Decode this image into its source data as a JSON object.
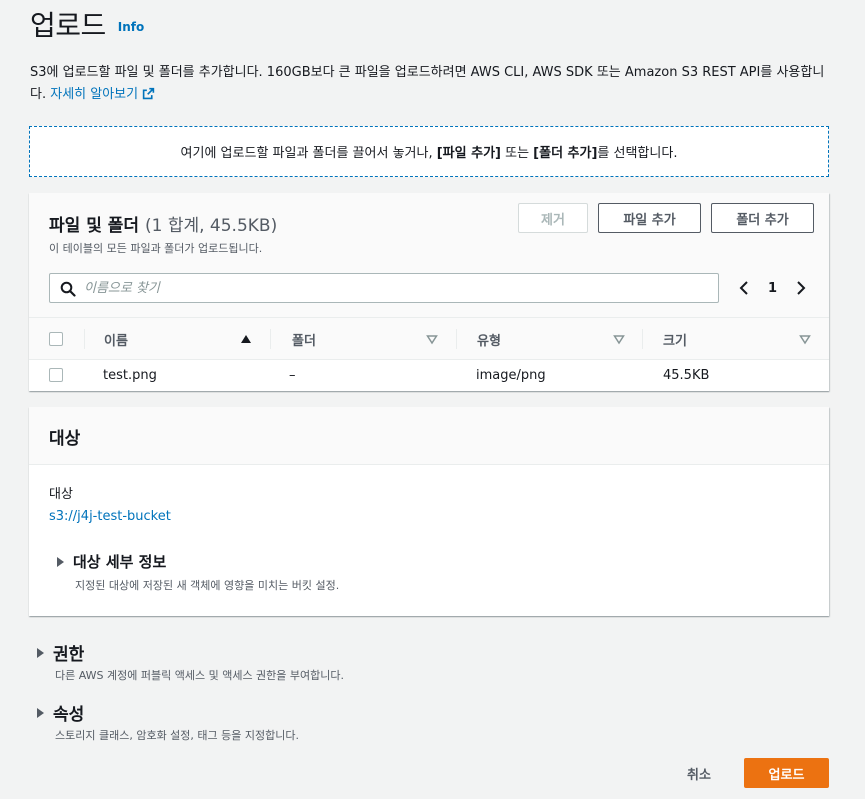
{
  "header": {
    "title": "업로드",
    "info": "Info"
  },
  "description": {
    "text": "S3에 업로드할 파일 및 폴더를 추가합니다. 160GB보다 큰 파일을 업로드하려면 AWS CLI, AWS SDK 또는 Amazon S3 REST API를 사용합니다.",
    "link": "자세히 알아보기"
  },
  "dropzone": {
    "prefix": "여기에 업로드할 파일과 폴더를 끌어서 놓거나, ",
    "file_label": "[파일 추가]",
    "middle": " 또는 ",
    "folder_label": "[폴더 추가]",
    "suffix": "를 선택합니다."
  },
  "files": {
    "title": "파일 및 폴더",
    "count": "(1 합계, 45.5KB)",
    "subtitle": "이 테이블의 모든 파일과 폴더가 업로드됩니다.",
    "remove_button": "제거",
    "add_files_button": "파일 추가",
    "add_folder_button": "폴더 추가",
    "search_placeholder": "이름으로 찾기",
    "page": "1",
    "columns": [
      "이름",
      "폴더",
      "유형",
      "크기"
    ],
    "rows": [
      {
        "name": "test.png",
        "folder": "–",
        "type": "image/png",
        "size": "45.5KB"
      }
    ]
  },
  "destination": {
    "title": "대상",
    "label": "대상",
    "bucket": "s3://j4j-test-bucket",
    "details_title": "대상 세부 정보",
    "details_sub": "지정된 대상에 저장된 새 객체에 영향을 미치는 버킷 설정."
  },
  "permissions": {
    "title": "권한",
    "sub": "다른 AWS 계정에 퍼블릭 액세스 및 액세스 권한을 부여합니다."
  },
  "properties": {
    "title": "속성",
    "sub": "스토리지 클래스, 암호화 설정, 태그 등을 지정합니다."
  },
  "footer": {
    "cancel": "취소",
    "upload": "업로드"
  },
  "colors": {
    "link": "#0073bb",
    "primary": "#ec7211",
    "background": "#f2f3f3"
  }
}
